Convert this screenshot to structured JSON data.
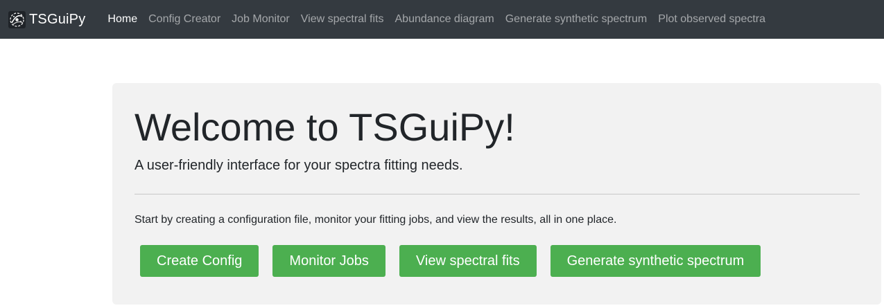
{
  "colors": {
    "navbar_bg": "#343a40",
    "nav_active": "#ffffff",
    "nav_inactive": "rgba(255,255,255,0.55)",
    "panel_bg": "#f2f2f2",
    "button_bg": "#4caf50",
    "button_text": "#ffffff"
  },
  "navbar": {
    "brand": {
      "logo_icon": "galaxy-logo-icon",
      "text": "TSGuiPy"
    },
    "links": [
      {
        "label": "Home",
        "active": true
      },
      {
        "label": "Config Creator",
        "active": false
      },
      {
        "label": "Job Monitor",
        "active": false
      },
      {
        "label": "View spectral fits",
        "active": false
      },
      {
        "label": "Abundance diagram",
        "active": false
      },
      {
        "label": "Generate synthetic spectrum",
        "active": false
      },
      {
        "label": "Plot observed spectra",
        "active": false
      }
    ]
  },
  "main": {
    "title": "Welcome to TSGuiPy!",
    "lead": "A user-friendly interface for your spectra fitting needs.",
    "body": "Start by creating a configuration file, monitor your fitting jobs, and view the results, all in one place.",
    "buttons": [
      {
        "label": "Create Config"
      },
      {
        "label": "Monitor Jobs"
      },
      {
        "label": "View spectral fits"
      },
      {
        "label": "Generate synthetic spectrum"
      }
    ]
  }
}
